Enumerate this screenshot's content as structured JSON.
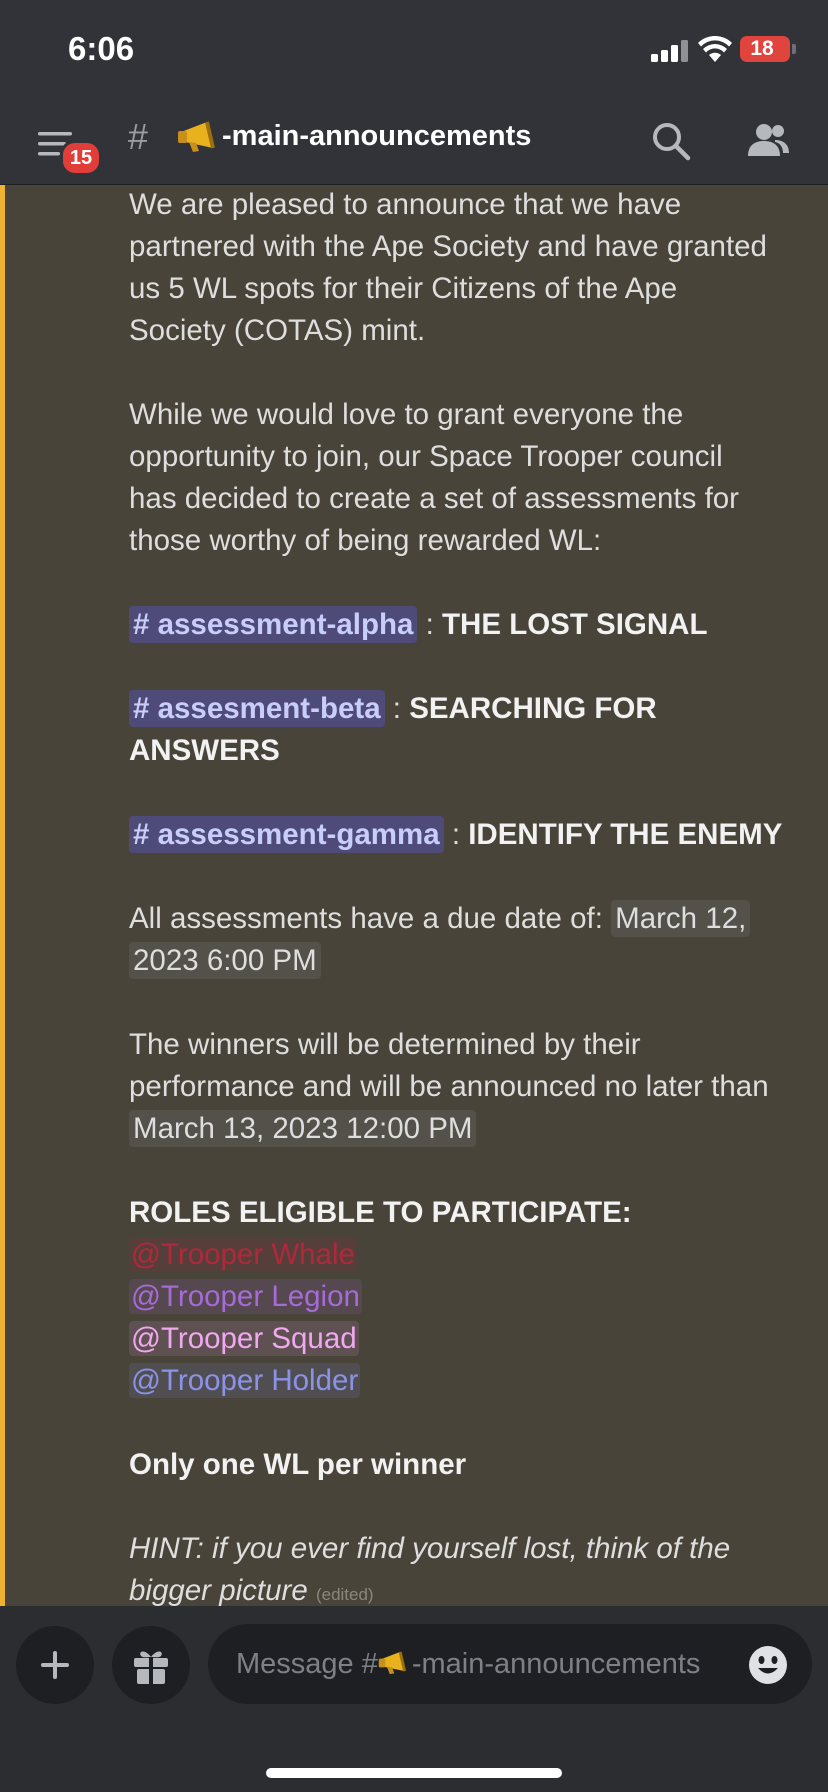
{
  "status_bar": {
    "time": "6:06",
    "battery": "18",
    "icons": [
      "signal-icon",
      "wifi-icon",
      "battery-icon"
    ]
  },
  "header": {
    "menu_icon": "menu-icon",
    "notification_count": "15",
    "channel_hash": "#",
    "channel_emoji": "megaphone-icon",
    "channel_name": "-main-announcements",
    "search_icon": "search-icon",
    "members_icon": "members-icon"
  },
  "message": {
    "intro_lines": [
      "We are pleased to announce that we have",
      "partnered with the Ape Society and have granted",
      "us 5 WL spots for their Citizens of the Ape",
      "Society (COTAS) mint."
    ],
    "para2_lines": [
      "While we would love to grant everyone the",
      "opportunity to join, our Space Trooper council",
      "has decided to create a set of assessments for",
      "those worthy of being rewarded WL:"
    ],
    "assessments": [
      {
        "channel": "# assessment-alpha",
        "sep": " : ",
        "title": "THE LOST SIGNAL"
      },
      {
        "channel": "# assesment-beta",
        "sep": " : ",
        "title": "SEARCHING FOR",
        "title_cont": "ANSWERS"
      },
      {
        "channel": "# assessment-gamma",
        "sep": " : ",
        "title": "IDENTIFY THE ENEMY"
      }
    ],
    "due_text": "All assessments have a due date of: ",
    "due_date_part1": "March 12,",
    "due_date_part2": "2023 6:00 PM",
    "winners_lines": [
      "The winners will be determined by their",
      "performance and will be announced no later than"
    ],
    "winners_date": "March 13, 2023 12:00 PM",
    "roles_heading": "ROLES ELIGIBLE TO PARTICIPATE:",
    "roles": [
      {
        "name": "@Trooper Whale",
        "color": "#b0283c"
      },
      {
        "name": "@Trooper Legion",
        "color": "#a66bd6"
      },
      {
        "name": "@Trooper Squad",
        "color": "#f0a8f0"
      },
      {
        "name": "@Trooper Holder",
        "color": "#8a93e8"
      }
    ],
    "one_wl": "Only one WL per winner",
    "hint_line1": "HINT: if you ever find yourself lost, think of the",
    "hint_line2": "bigger picture",
    "edited": "(edited)"
  },
  "composer": {
    "add_icon": "plus-icon",
    "gift_icon": "gift-icon",
    "placeholder_prefix": "Message #",
    "placeholder_channel": "-main-announcements",
    "emoji_icon": "smiley-icon"
  }
}
